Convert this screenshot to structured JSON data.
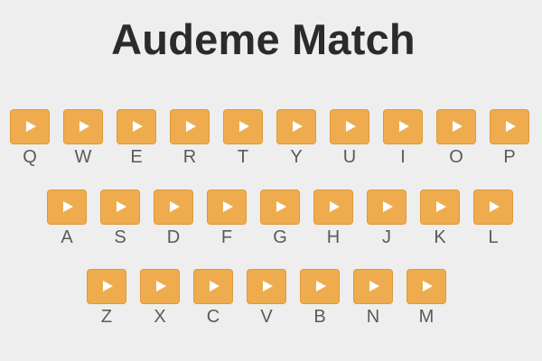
{
  "title": "Audeme Match",
  "keyboard": {
    "rows": [
      [
        "Q",
        "W",
        "E",
        "R",
        "T",
        "Y",
        "U",
        "I",
        "O",
        "P"
      ],
      [
        "A",
        "S",
        "D",
        "F",
        "G",
        "H",
        "J",
        "K",
        "L"
      ],
      [
        "Z",
        "X",
        "C",
        "V",
        "B",
        "N",
        "M"
      ]
    ]
  },
  "colors": {
    "key_fill": "#efac4e",
    "key_border": "#dc9a3b",
    "play_icon": "#ffffff",
    "label": "#5a5a5a",
    "title": "#2b2b2b",
    "background": "#eeeeee"
  },
  "icons": {
    "key_icon": "play-icon"
  }
}
